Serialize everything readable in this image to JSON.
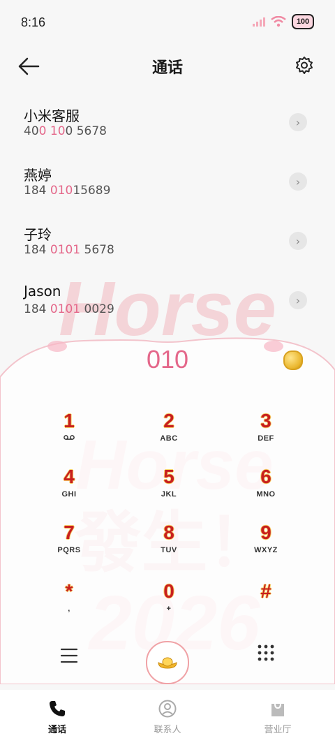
{
  "status_bar": {
    "time": "8:16",
    "battery": "100"
  },
  "header": {
    "title": "通话"
  },
  "contacts": [
    {
      "name": "小米客服",
      "number_parts": [
        "40",
        "0",
        " ",
        "10",
        "0 5678"
      ]
    },
    {
      "name": "燕婷",
      "number_parts": [
        "184 ",
        "010",
        "15689"
      ]
    },
    {
      "name": "子玲",
      "number_parts": [
        "184 ",
        "0101",
        " 5678"
      ]
    },
    {
      "name": "Jason",
      "number_parts": [
        "184 ",
        "0101",
        " 0029"
      ]
    }
  ],
  "dialer": {
    "dialed_number": "010",
    "keys": [
      {
        "digit": "1",
        "letters": "ᴼᴼ"
      },
      {
        "digit": "2",
        "letters": "ABC"
      },
      {
        "digit": "3",
        "letters": "DEF"
      },
      {
        "digit": "4",
        "letters": "GHI"
      },
      {
        "digit": "5",
        "letters": "JKL"
      },
      {
        "digit": "6",
        "letters": "MNO"
      },
      {
        "digit": "7",
        "letters": "PQRS"
      },
      {
        "digit": "8",
        "letters": "TUV"
      },
      {
        "digit": "9",
        "letters": "WXYZ"
      },
      {
        "digit": "*",
        "letters": ","
      },
      {
        "digit": "0",
        "letters": "+"
      },
      {
        "digit": "#",
        "letters": ""
      }
    ]
  },
  "theme_art": {
    "word": "Horse",
    "chinese": "發生！",
    "year": "2026"
  },
  "tabbar": {
    "items": [
      {
        "label": "通话",
        "icon": "phone-icon",
        "active": true
      },
      {
        "label": "联系人",
        "icon": "contact-person-icon",
        "active": false
      },
      {
        "label": "营业厅",
        "icon": "shopping-bag-icon",
        "active": false
      }
    ]
  },
  "colors": {
    "accent_pink": "#e4678a",
    "digit_red": "#c81f1f",
    "call_ring": "#f0a2a6"
  }
}
